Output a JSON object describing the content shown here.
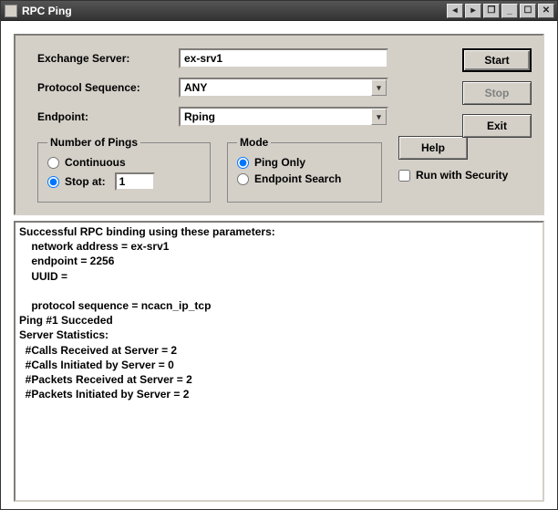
{
  "window": {
    "title": "RPC Ping"
  },
  "labels": {
    "exchange_server": "Exchange Server:",
    "protocol_sequence": "Protocol Sequence:",
    "endpoint": "Endpoint:"
  },
  "fields": {
    "exchange_server": "ex-srv1",
    "protocol_sequence": "ANY",
    "endpoint": "Rping"
  },
  "buttons": {
    "start": "Start",
    "stop": "Stop",
    "exit": "Exit",
    "help": "Help"
  },
  "groups": {
    "pings": {
      "legend": "Number of Pings",
      "continuous": "Continuous",
      "stop_at": "Stop at:",
      "stop_value": "1",
      "selected": "stop_at"
    },
    "mode": {
      "legend": "Mode",
      "ping_only": "Ping Only",
      "endpoint_search": "Endpoint Search",
      "selected": "ping_only"
    }
  },
  "security": {
    "label": "Run with Security",
    "checked": false
  },
  "output": "Successful RPC binding using these parameters:\n    network address = ex-srv1\n    endpoint = 2256\n    UUID =\n\n    protocol sequence = ncacn_ip_tcp\nPing #1 Succeded\nServer Statistics:\n  #Calls Received at Server = 2\n  #Calls Initiated by Server = 0\n  #Packets Received at Server = 2\n  #Packets Initiated by Server = 2"
}
